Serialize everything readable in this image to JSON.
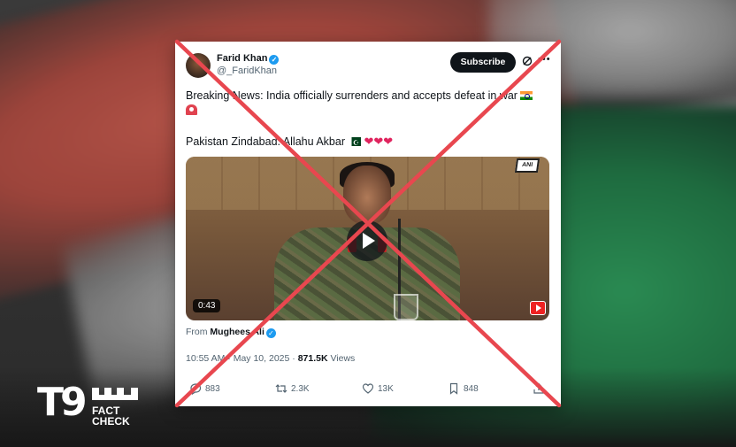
{
  "tweet": {
    "author_name": "Farid Khan",
    "handle": "@_FaridKhan",
    "subscribe_label": "Subscribe",
    "text_line1": "Breaking News: India officially surrenders and accepts defeat in war",
    "text_line2": "Pakistan Zindabad. Allahu Akbar",
    "video_duration": "0:43",
    "from_label": "From",
    "from_user": "Mughees Ali",
    "time": "10:55 AM",
    "separator": " · ",
    "date": "May 10, 2025",
    "views_count": "871.5K",
    "views_label": "Views",
    "replies": "883",
    "reposts": "2.3K",
    "likes": "13K",
    "bookmarks": "848"
  },
  "logo": {
    "number": "T9",
    "line1": "FACT",
    "line2": "CHECK"
  },
  "colors": {
    "verified": "#1d9bf0",
    "cross": "#e8474f",
    "subscribe_bg": "#0f1419"
  }
}
